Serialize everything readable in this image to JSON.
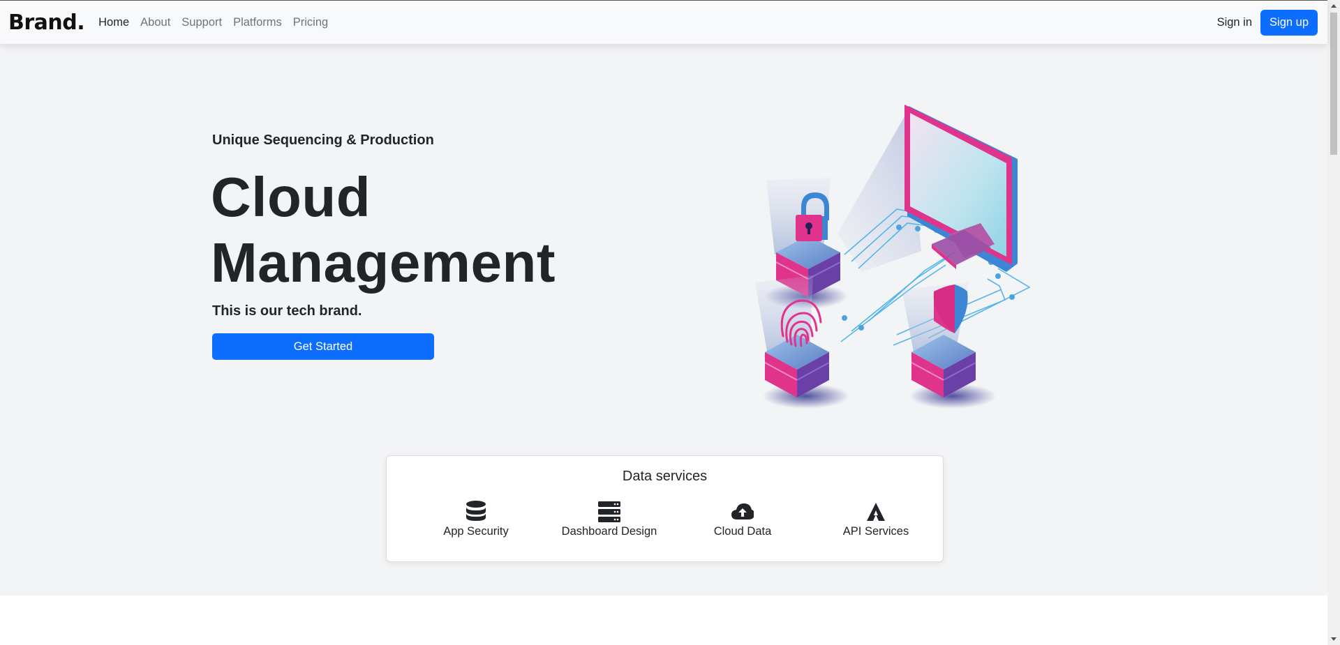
{
  "nav": {
    "brand": "Brand.",
    "links": [
      "Home",
      "About",
      "Support",
      "Platforms",
      "Pricing"
    ],
    "signin": "Sign in",
    "signup": "Sign up"
  },
  "hero": {
    "eyebrow": "Unique Sequencing & Production",
    "title_line1": "Cloud",
    "title_line2": "Management",
    "subtitle": "This is our tech brand.",
    "cta": "Get Started",
    "illustration_icon": "isometric-security-illustration"
  },
  "services": {
    "title": "Data services",
    "items": [
      {
        "label": "App Security",
        "icon": "database-icon"
      },
      {
        "label": "Dashboard Design",
        "icon": "server-icon"
      },
      {
        "label": "Cloud Data",
        "icon": "cloud-upload-icon"
      },
      {
        "label": "API Services",
        "icon": "atlassian-icon"
      }
    ]
  },
  "colors": {
    "primary": "#0d6efd",
    "background": "#f3f4f6",
    "navbar": "#f8f9fa",
    "magenta": "#e0338c",
    "blue": "#4a8fd8"
  }
}
